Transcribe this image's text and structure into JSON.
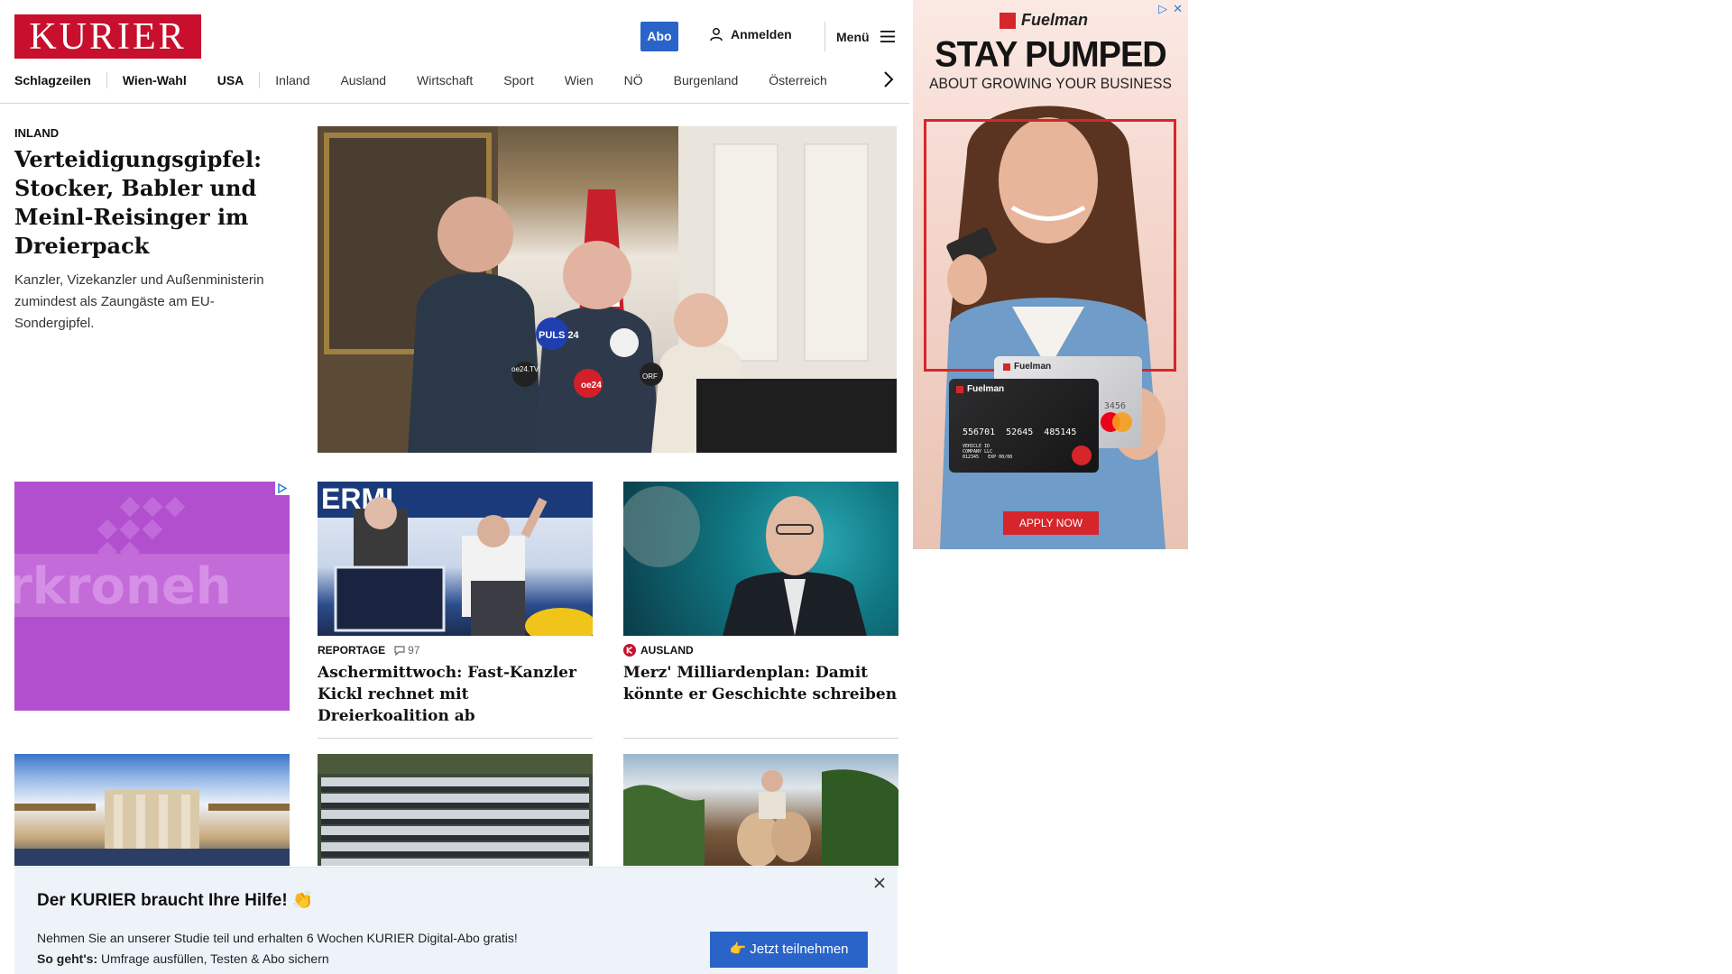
{
  "header": {
    "logo": "KURIER",
    "abo_label": "Abo",
    "login_label": "Anmelden",
    "menu_label": "Menü"
  },
  "nav": {
    "items": [
      "Schlagzeilen",
      "Wien-Wahl",
      "USA",
      "Inland",
      "Ausland",
      "Wirtschaft",
      "Sport",
      "Wien",
      "NÖ",
      "Burgenland",
      "Österreich"
    ]
  },
  "hero": {
    "kicker": "INLAND",
    "title": "Verteidigungsgipfel: Stocker, Babler und Meinl-Reisinger im Dreierpack",
    "teaser": "Kanzler, Vizekanzler und Außenministerin zumindest als Zaungäste am EU-Sondergipfel.",
    "image_mic_labels": [
      "PULS 24",
      "oe24.TV",
      "oe24",
      "ORF"
    ]
  },
  "ad_left": {
    "watermark": "rkroneh"
  },
  "cards": [
    {
      "kicker": "REPORTAGE",
      "comments": "97",
      "title": "Aschermittwoch: Fast-Kanzler Kickl rechnet mit Dreierkoalition ab",
      "image_text": "ERMI"
    },
    {
      "kicker": "AUSLAND",
      "title": "Merz' Milliardenplan: Damit könnte er Geschichte schreiben"
    }
  ],
  "side_ad": {
    "brand": "Fuelman",
    "headline": "STAY PUMPED",
    "subline": "ABOUT GROWING YOUR BUSINESS",
    "card_number": "556701  52645  485145",
    "card_number_partial": "3456",
    "card_text": [
      "VEHICLE ID",
      "COMPANY LLC",
      "012345",
      "EXP 00/00"
    ],
    "cta": "APPLY NOW"
  },
  "popup": {
    "title": "Der KURIER braucht Ihre Hilfe! 👏",
    "line1": "Nehmen Sie an unserer Studie teil und erhalten 6 Wochen KURIER Digital-Abo gratis!",
    "line2_bold": "So geht's:",
    "line2": "Umfrage ausfüllen, Testen & Abo sichern",
    "button": "👉 Jetzt teilnehmen"
  },
  "colors": {
    "brand_red": "#c8102e",
    "accent_blue": "#2a64c8",
    "ad_purple": "#b24fcf",
    "fuelman_red": "#d6262b"
  }
}
